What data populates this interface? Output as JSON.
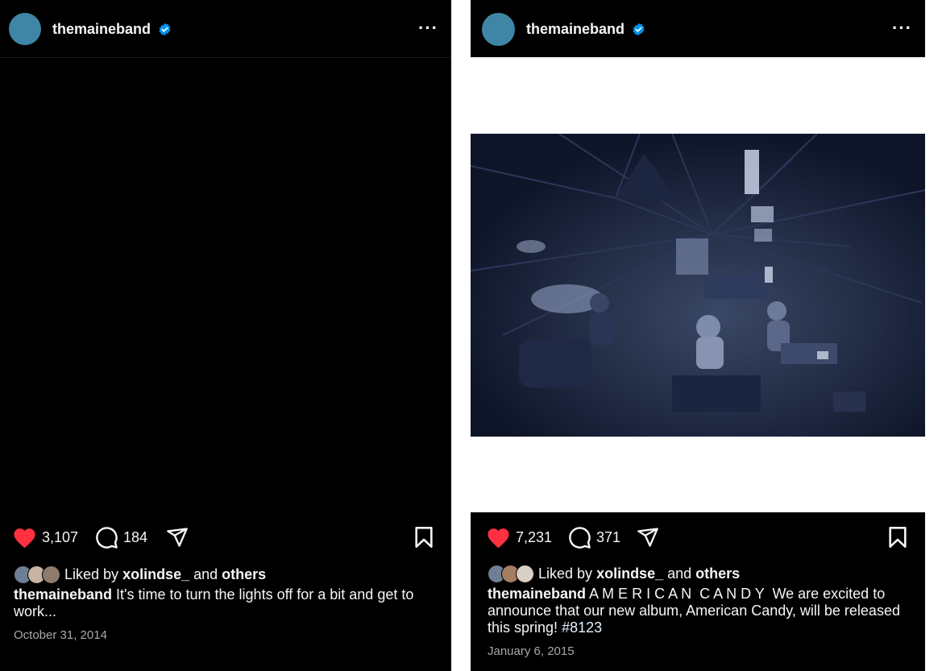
{
  "posts": [
    {
      "username": "themaineband",
      "likes": "3,107",
      "comments": "184",
      "liked_by_prefix": "Liked by",
      "liked_by_user": "xolindse_",
      "liked_by_and": "and",
      "liked_by_others": "others",
      "caption_user": "themaineband",
      "caption_text": "It's time to turn the lights off for a bit and get to work...",
      "date": "October 31, 2014"
    },
    {
      "username": "themaineband",
      "likes": "7,231",
      "comments": "371",
      "liked_by_prefix": "Liked by",
      "liked_by_user": "xolindse_",
      "liked_by_and": "and",
      "liked_by_others": "others",
      "caption_user": "themaineband",
      "caption_text": "A M E R I C A N  C A N D Y  We are excited to announce that our new album, American Candy, will be released this spring!",
      "caption_hashtag": "#8123",
      "date": "January 6, 2015"
    }
  ],
  "colors": {
    "background": "#000000",
    "like_heart": "#ff3040",
    "verified_badge": "#0095f6",
    "avatar": "#3f86a6",
    "date_text": "#a8a8a8"
  },
  "icons": [
    "heart-icon",
    "comment-icon",
    "share-icon",
    "bookmark-icon",
    "verified-icon",
    "more-options-icon"
  ]
}
